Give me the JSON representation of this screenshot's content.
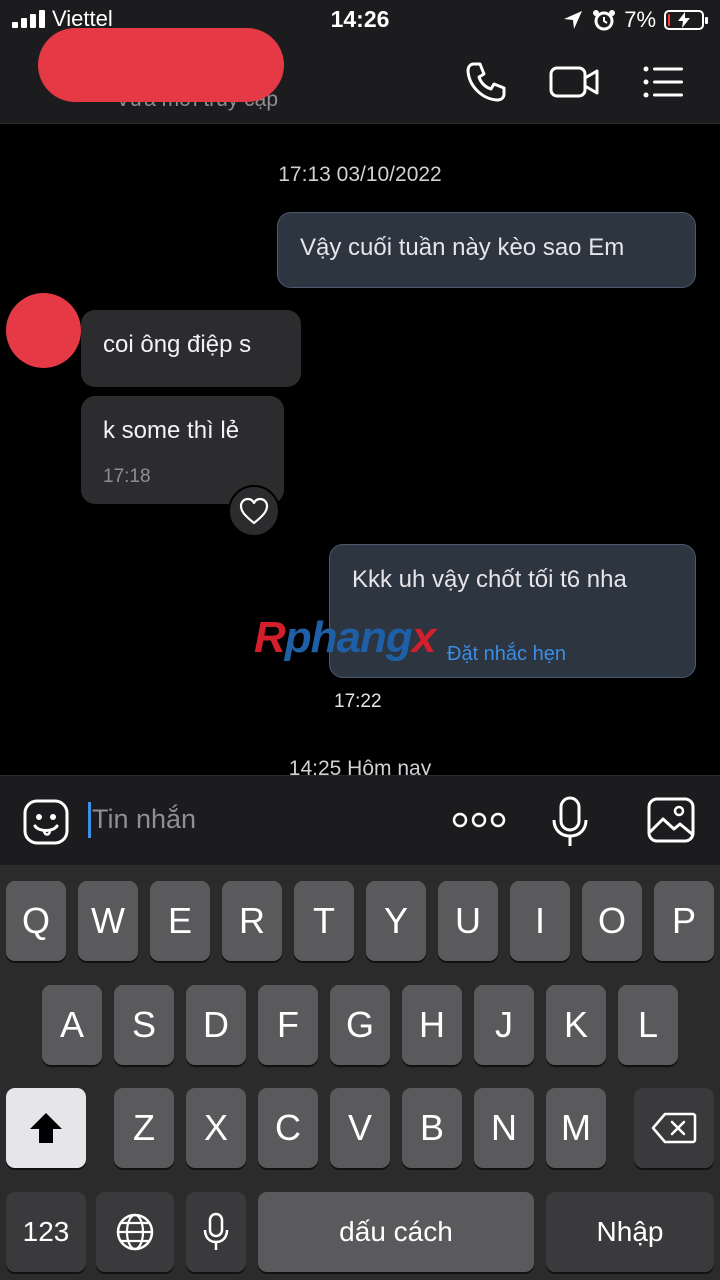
{
  "status_bar": {
    "carrier": "Viettel",
    "time": "14:26",
    "battery_percent": "7%",
    "battery_level": 0.07,
    "icons": [
      "signal-bars-icon",
      "wifi-icon",
      "location-arrow-icon",
      "alarm-icon",
      "battery-charging-icon"
    ]
  },
  "header": {
    "contact_status": "Vừa mới truy cập",
    "icons": [
      "phone-icon",
      "video-call-icon",
      "menu-list-icon"
    ]
  },
  "chat": {
    "date_separator_1": "17:13 03/10/2022",
    "messages": [
      {
        "direction": "out",
        "text": "Vậy cuối tuần này kèo sao Em"
      },
      {
        "direction": "in",
        "text": "coi ông điệp s"
      },
      {
        "direction": "in",
        "text": "k some thì lẻ",
        "time": "17:18"
      },
      {
        "direction": "out",
        "text": "Kkk uh vậy chốt tối t6 nha",
        "link": "Đặt nhắc hẹn",
        "time": "17:22"
      }
    ],
    "watermark": {
      "part1": "R",
      "part2": "phang",
      "part3": "x"
    },
    "date_separator_2": "14:25 Hôm nay"
  },
  "input_bar": {
    "placeholder": "Tin nhắn",
    "icons": [
      "emoji-sticker-icon",
      "more-dots-icon",
      "microphone-icon",
      "image-icon"
    ]
  },
  "keyboard": {
    "row1": [
      "Q",
      "W",
      "E",
      "R",
      "T",
      "Y",
      "U",
      "I",
      "O",
      "P"
    ],
    "row2": [
      "A",
      "S",
      "D",
      "F",
      "G",
      "H",
      "J",
      "K",
      "L"
    ],
    "row3": [
      "Z",
      "X",
      "C",
      "V",
      "B",
      "N",
      "M"
    ],
    "numbers_label": "123",
    "space_label": "dấu cách",
    "return_label": "Nhập"
  }
}
